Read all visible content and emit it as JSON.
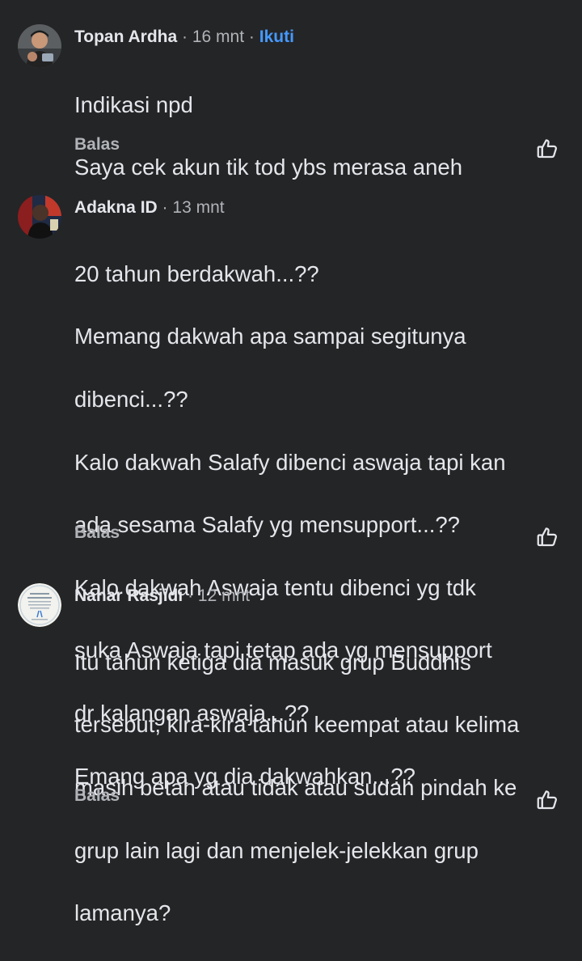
{
  "comments": [
    {
      "author": "Topan Ardha",
      "separator": "·",
      "time": "16 mnt",
      "follow_label": "Ikuti",
      "lines": [
        "Indikasi npd",
        "Saya cek akun tik tod ybs merasa aneh"
      ],
      "reply_label": "Balas",
      "like_icon": "thumbs-up-icon"
    },
    {
      "author": "Adakna ID",
      "separator": "·",
      "time": "13 mnt",
      "lines": [
        "20 tahun berdakwah...??",
        "Memang dakwah apa sampai segitunya",
        "dibenci...??",
        "Kalo dakwah Salafy dibenci aswaja tapi kan",
        "ada sesama Salafy yg mensupport...??",
        "Kalo dakwah Aswaja tentu dibenci yg tdk",
        "suka Aswaja tapi tetap ada yg mensupport",
        "dr kalangan aswaja...??",
        "Emang apa yg dia dakwahkan...??"
      ],
      "reply_label": "Balas",
      "like_icon": "thumbs-up-icon"
    },
    {
      "author": "Nahar Rasjidi",
      "separator": "·",
      "time": "12 mnt",
      "lines": [
        "Itu tahun ketiga dia masuk grup Buddhis",
        "tersebut, kira-kira tahun keempat atau kelima",
        "masih betah atau tidak atau sudah pindah ke",
        "grup lain lagi dan menjelek-jelekkan grup",
        "lamanya?"
      ],
      "reply_label": "Balas",
      "like_icon": "thumbs-up-icon"
    }
  ],
  "colors": {
    "background": "#242526",
    "primary_text": "#e4e6eb",
    "secondary_text": "#b0b3b8",
    "link_blue": "#4599ff"
  }
}
